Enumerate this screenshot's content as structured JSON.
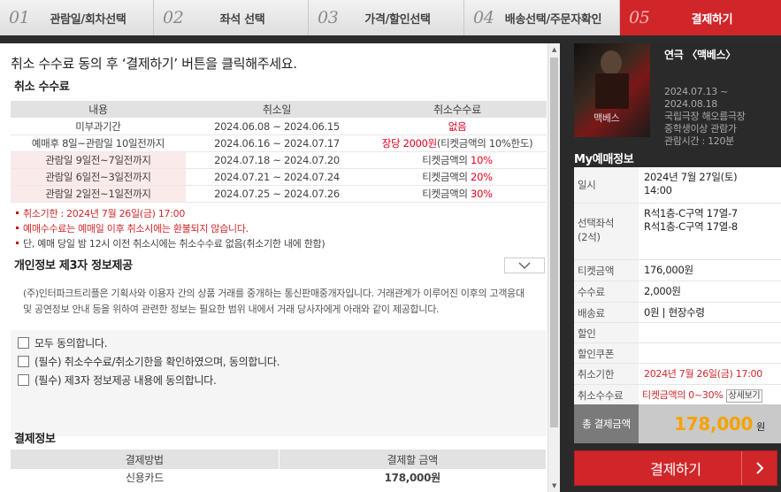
{
  "steps": [
    {
      "num": "01",
      "label": "관람일/회차선택"
    },
    {
      "num": "02",
      "label": "좌석 선택"
    },
    {
      "num": "03",
      "label": "가격/할인선택"
    },
    {
      "num": "04",
      "label": "배송선택/주문자확인"
    },
    {
      "num": "05",
      "label": "결제하기"
    }
  ],
  "instruction": "취소 수수료 동의 후 ‘결제하기’ 버튼을 클릭해주세요.",
  "cancel_fee": {
    "title": "취소 수수료",
    "headers": [
      "내용",
      "취소일",
      "취소수수료"
    ],
    "rows": [
      {
        "content": "미부과기간",
        "date": "2024.06.08 ~ 2024.06.15",
        "fee": "없음",
        "fee_suffix": ""
      },
      {
        "content": "예매후 8일~관람일 10일전까지",
        "date": "2024.06.16 ~ 2024.07.17",
        "fee": "장당 2000원",
        "fee_suffix": "(티켓금액의 10%한도)"
      },
      {
        "content": "관람일 9일전~7일전까지",
        "date": "2024.07.18 ~ 2024.07.20",
        "fee_prefix": "티켓금액의 ",
        "fee": "10%"
      },
      {
        "content": "관람일 6일전~3일전까지",
        "date": "2024.07.21 ~ 2024.07.24",
        "fee_prefix": "티켓금액의 ",
        "fee": "20%"
      },
      {
        "content": "관람일 2일전~1일전까지",
        "date": "2024.07.25 ~ 2024.07.26",
        "fee_prefix": "티켓금액의 ",
        "fee": "30%"
      }
    ]
  },
  "notes": [
    "취소기한 : 2024년 7월 26일(금) 17:00",
    "예매수수료는 예매일 이후 취소시에는 환불되지 않습니다.",
    "단, 예매 당일 밤 12시 이전 취소시에는 취소수수료 없음(취소기한 내에 한함)"
  ],
  "privacy": {
    "title": "개인정보 제3자 정보제공",
    "text": "(주)인터파크트리플은 기획사와 이용자 간의 상품 거래를 중개하는 통신판매중개자입니다. 거래관계가 이루어진 이후의 고객응대 및 공연정보 안내 등을 위하여 관련한 정보는 필요한 범위 내에서 거래 당사자에게 아래와 같이 제공합니다."
  },
  "agreements": [
    "모두 동의합니다.",
    "(필수) 취소수수료/취소기한을 확인하였으며, 동의합니다.",
    "(필수) 제3자 정보제공 내용에 동의합니다."
  ],
  "payment": {
    "title": "결제정보",
    "headers": [
      "결제방법",
      "결제할 금액"
    ],
    "method": "신용카드",
    "amount": "178,000원"
  },
  "show": {
    "title": "연극 〈맥베스〉",
    "poster_title": "맥베스",
    "info": [
      "2024.07.13 ~",
      "2024.08.18",
      "국립극장 해오름극장",
      "중학생이상 관람가",
      "관람시간 : 120분"
    ]
  },
  "my_booking": {
    "title": "My예매정보",
    "rows": [
      {
        "key": "일시",
        "value": [
          "2024년 7월 27일(토)",
          "14:00"
        ]
      },
      {
        "key": "선택좌석(2석)",
        "value": [
          "R석1층-C구역 17열-7",
          "R석1층-C구역 17열-8"
        ]
      },
      {
        "key": "티켓금액",
        "value": [
          "176,000원"
        ]
      },
      {
        "key": "수수료",
        "value": [
          "2,000원"
        ]
      },
      {
        "key": "배송료",
        "value": [
          "0원 | 현장수령"
        ]
      },
      {
        "key": "할인",
        "value": [
          ""
        ]
      },
      {
        "key": "할인쿠폰",
        "value": [
          ""
        ]
      },
      {
        "key": "취소기한",
        "value": [
          "2024년 7월 26일(금) 17:00"
        ]
      },
      {
        "key": "취소수수료",
        "value": [
          "티켓금액의 0~30%"
        ]
      }
    ],
    "detail_label": "상세보기",
    "total_label": "총 결제금액",
    "total_amount": "178,000",
    "total_unit": "원"
  },
  "pay_button": "결제하기",
  "colors": {
    "accent": "#d0262a",
    "total": "#f5a300"
  }
}
